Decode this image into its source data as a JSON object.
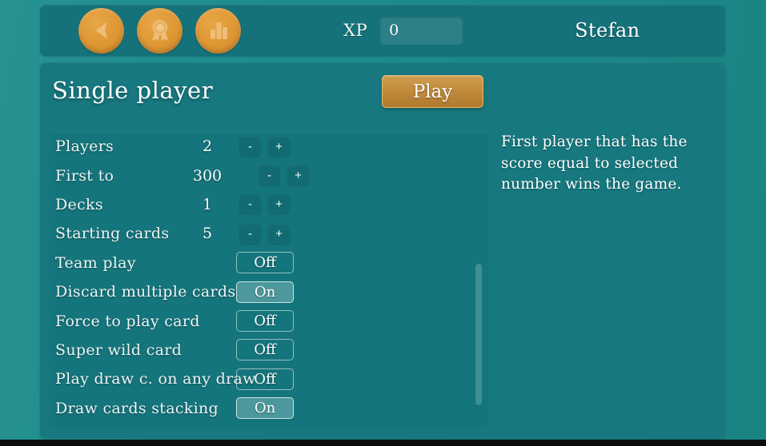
{
  "colors": {
    "backdrop": "#1c8c8c",
    "topbar": "#15727a",
    "panel": "#17787f",
    "settings_panel": "#15757c",
    "accent_orange": "#dd9733",
    "play_button": "#c18b3c",
    "text": "#ffffff"
  },
  "topbar": {
    "icons": [
      {
        "name": "back-icon",
        "label": "Back"
      },
      {
        "name": "achievements-icon",
        "label": "Achievements"
      },
      {
        "name": "statistics-icon",
        "label": "Statistics"
      }
    ],
    "xp_label": "XP",
    "xp_value": "0",
    "player_name": "Stefan"
  },
  "main": {
    "title": "Single player",
    "play_label": "Play",
    "settings": [
      {
        "label": "Players",
        "type": "stepper",
        "value": "2",
        "minus": "-",
        "plus": "+",
        "wide": false
      },
      {
        "label": "First to",
        "type": "stepper",
        "value": "300",
        "minus": "-",
        "plus": "+",
        "wide": true
      },
      {
        "label": "Decks",
        "type": "stepper",
        "value": "1",
        "minus": "-",
        "plus": "+",
        "wide": false
      },
      {
        "label": "Starting cards",
        "type": "stepper",
        "value": "5",
        "minus": "-",
        "plus": "+",
        "wide": false
      },
      {
        "label": "Team play",
        "type": "toggle",
        "value": "Off",
        "on": false
      },
      {
        "label": "Discard multiple cards",
        "type": "toggle",
        "value": "On",
        "on": true
      },
      {
        "label": "Force to play card",
        "type": "toggle",
        "value": "Off",
        "on": false
      },
      {
        "label": "Super wild card",
        "type": "toggle",
        "value": "Off",
        "on": false
      },
      {
        "label": "Play draw c. on any draw",
        "type": "toggle",
        "value": "Off",
        "on": false
      },
      {
        "label": "Draw cards stacking",
        "type": "toggle",
        "value": "On",
        "on": true
      }
    ],
    "info_text": "First player that has the score equal to selected number wins the game."
  }
}
